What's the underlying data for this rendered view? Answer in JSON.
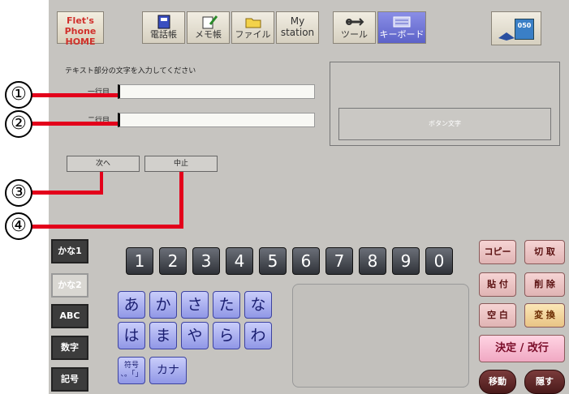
{
  "toolbar": {
    "home_line1": "Flet's Phone",
    "home_line2": "HOME",
    "buttons": [
      {
        "label": "電話帳",
        "icon": "phonebook-icon"
      },
      {
        "label": "メモ帳",
        "icon": "memo-icon"
      },
      {
        "label": "ファイル",
        "icon": "folder-icon"
      },
      {
        "label": "My station",
        "icon": "none"
      },
      {
        "label": "ツール",
        "icon": "tool-icon"
      },
      {
        "label": "キーボード",
        "icon": "keyboard-icon"
      }
    ],
    "active_button": "キーボード",
    "badge": "050"
  },
  "form": {
    "prompt": "テキスト部分の文字を入力してください",
    "row1_label": "一行目",
    "row1_value": "",
    "row2_label": "二行目",
    "row2_value": "",
    "preview_button": "ボタン文字",
    "next_button": "次へ",
    "cancel_button": "中止"
  },
  "annotations": [
    "①",
    "②",
    "③",
    "④"
  ],
  "keyboard": {
    "modes": [
      "かな1",
      "かな2",
      "ABC",
      "数字",
      "記号"
    ],
    "selected_mode": "かな2",
    "numbers": [
      "1",
      "2",
      "3",
      "4",
      "5",
      "6",
      "7",
      "8",
      "9",
      "0"
    ],
    "kana_row1": [
      "あ",
      "か",
      "さ",
      "た",
      "な"
    ],
    "kana_row2": [
      "は",
      "ま",
      "や",
      "ら",
      "わ"
    ],
    "symbol_key": "符号\n、。「」",
    "katakana_key": "カナ",
    "functions": {
      "copy": "コピー",
      "cut": "切 取",
      "paste": "貼 付",
      "delete": "削 除",
      "space": "空 白",
      "convert": "変 換",
      "enter": "決定 / 改行",
      "move": "移動",
      "hide": "隠す"
    }
  },
  "colors": {
    "annotation_line": "#e3001b",
    "active_tab": "#5c62c8",
    "kana_key": "#9097e6"
  }
}
